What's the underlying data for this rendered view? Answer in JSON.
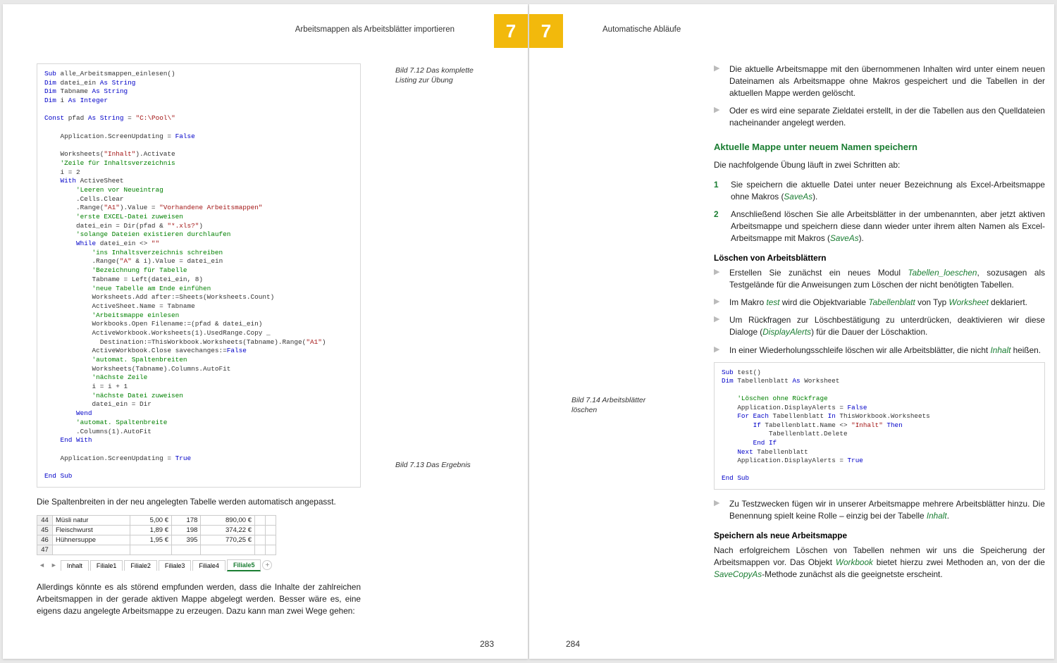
{
  "runhead_left": "Arbeitsmappen als Arbeitsblätter importieren",
  "runhead_right": "Automatische Abläufe",
  "chapter": "7",
  "pagenum_left": "283",
  "pagenum_right": "284",
  "cap712": "Bild 7.12 Das komplette Listing zur Übung",
  "cap713": "Bild 7.13 Das Ergebnis",
  "cap714": "Bild 7.14 Arbeitsblätter löschen",
  "left": {
    "para1": "Die Spaltenbreiten in der neu angelegten Tabelle werden automatisch angepasst.",
    "para2": "Allerdings könnte es als störend empfunden werden, dass die Inhalte der zahlreichen Arbeitsmappen in der gerade aktiven Mappe abgelegt werden. Besser wäre es, eine eigens dazu angelegte Arbeitsmappe zu erzeugen. Dazu kann man zwei Wege gehen:",
    "tabs": [
      "Inhalt",
      "Filiale1",
      "Filiale2",
      "Filiale3",
      "Filiale4",
      "Filiale5"
    ],
    "chart_data": {
      "type": "table",
      "rows": [
        {
          "n": "44",
          "name": "Müsli natur",
          "price": "5,00 €",
          "qty": "178",
          "total": "890,00 €"
        },
        {
          "n": "45",
          "name": "Fleischwurst",
          "price": "1,89 €",
          "qty": "198",
          "total": "374,22 €"
        },
        {
          "n": "46",
          "name": "Hühnersuppe",
          "price": "1,95 €",
          "qty": "395",
          "total": "770,25 €"
        },
        {
          "n": "47",
          "name": "",
          "price": "",
          "qty": "",
          "total": ""
        }
      ]
    }
  },
  "right": {
    "b1": "Die aktuelle Arbeitsmappe mit den übernommenen Inhalten wird unter einem neuen Dateinamen als Arbeitsmappe ohne Makros gespeichert und die Tabellen in der aktuellen Mappe werden gelöscht.",
    "b2": "Oder es wird eine separate Zieldatei erstellt, in der die Tabellen aus den Quelldateien nacheinander angelegt werden.",
    "h3": "Aktuelle Mappe unter neuem Namen speichern",
    "intro": "Die nachfolgende Übung läuft in zwei Schritten ab:",
    "s1a": "Sie speichern die aktuelle Datei unter neuer Bezeichnung als Excel-Arbeitsmappe ohne Makros (",
    "saveas": "SaveAs",
    "s1b": ").",
    "s2a": "Anschließend löschen Sie alle Arbeitsblätter in der umbenannten, aber jetzt aktiven Arbeitsmappe und speichern diese dann wieder unter ihrem alten Namen als Excel-Arbeitsmappe mit Makros (",
    "s2b": ").",
    "h4a": "Löschen von Arbeitsblättern",
    "lb1a": "Erstellen Sie zunächst ein neues Modul ",
    "lb1m": "Tabellen_loeschen",
    "lb1b": ", sozusagen als Testgelände für die Anweisungen zum Löschen der nicht benötigten Tabellen.",
    "lb2a": "Im Makro ",
    "lb2m1": "test",
    "lb2b": " wird die Objektvariable ",
    "lb2m2": "Tabellenblatt",
    "lb2c": " von Typ ",
    "lb2m3": "Worksheet",
    "lb2d": " deklariert.",
    "lb3a": "Um Rückfragen zur Löschbestätigung zu unterdrücken, deaktivieren wir diese Dialoge (",
    "lb3m": "DisplayAlerts",
    "lb3b": ") für die Dauer der Löschaktion.",
    "lb4a": "In einer Wiederholungsschleife löschen wir alle Arbeitsblätter, die nicht ",
    "lb4m": "Inhalt",
    "lb4b": " heißen.",
    "lb5a": "Zu Testzwecken fügen wir in unserer Arbeitsmappe mehrere Arbeitsblätter hinzu. Die Benennung spielt keine Rolle – einzig bei der Tabelle ",
    "lb5m": "Inhalt",
    "lb5b": ".",
    "h4b": "Speichern als neue Arbeitsmappe",
    "p_end_a": "Nach erfolgreichem Löschen von Tabellen nehmen wir uns die Speicherung der Arbeitsmappen vor. Das Objekt ",
    "p_end_m1": "Workbook",
    "p_end_b": " bietet hierzu zwei Methoden an, von der die ",
    "p_end_m2": "SaveCopyAs",
    "p_end_c": "-Methode zunächst als die geeignetste erscheint."
  }
}
